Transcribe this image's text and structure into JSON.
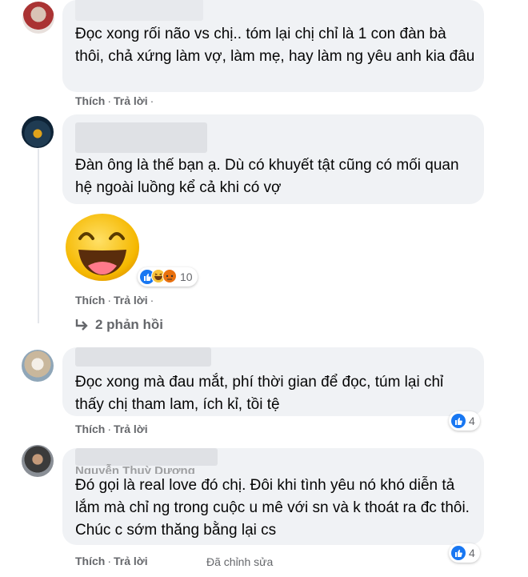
{
  "actions": {
    "like": "Thích",
    "reply": "Trả lời",
    "separator": "·"
  },
  "comments": [
    {
      "text": "Đọc xong rối não vs chị.. tóm lại chị chỉ là 1 con đàn bà thôi, chả xứng làm vợ, làm mẹ, hay làm ng yêu anh kia đâu"
    },
    {
      "text": "Đàn ông là thế bạn ạ. Dù có khuyết tật cũng có mối quan hệ ngoài luồng kể cả khi có vợ",
      "sticker": "laughing-face-sticker",
      "reactions": {
        "count": "10",
        "icons": [
          "like",
          "haha",
          "angry"
        ]
      },
      "replies_label": "2 phản hồi"
    },
    {
      "text": "Đọc xong mà đau mắt, phí thời gian để đọc, túm lại chỉ thấy chị tham lam, ích kỉ, tồi tệ",
      "reactions": {
        "count": "4",
        "icons": [
          "like"
        ]
      }
    },
    {
      "author": "Nguyễn Thuỳ Dương",
      "text": "Đó gọi là real love đó chị. Đôi khi tình yêu nó khó diễn tả lắm mà chỉ ng trong cuộc u mê với sn và k thoát ra đc thôi. Chúc c sớm thăng bằng lại cs",
      "edited": "Đã chỉnh sửa",
      "reactions": {
        "count": "4",
        "icons": [
          "like"
        ]
      }
    }
  ],
  "colors": {
    "bubble": "#f0f2f5",
    "meta": "#65676b",
    "like": "#1877f2"
  }
}
